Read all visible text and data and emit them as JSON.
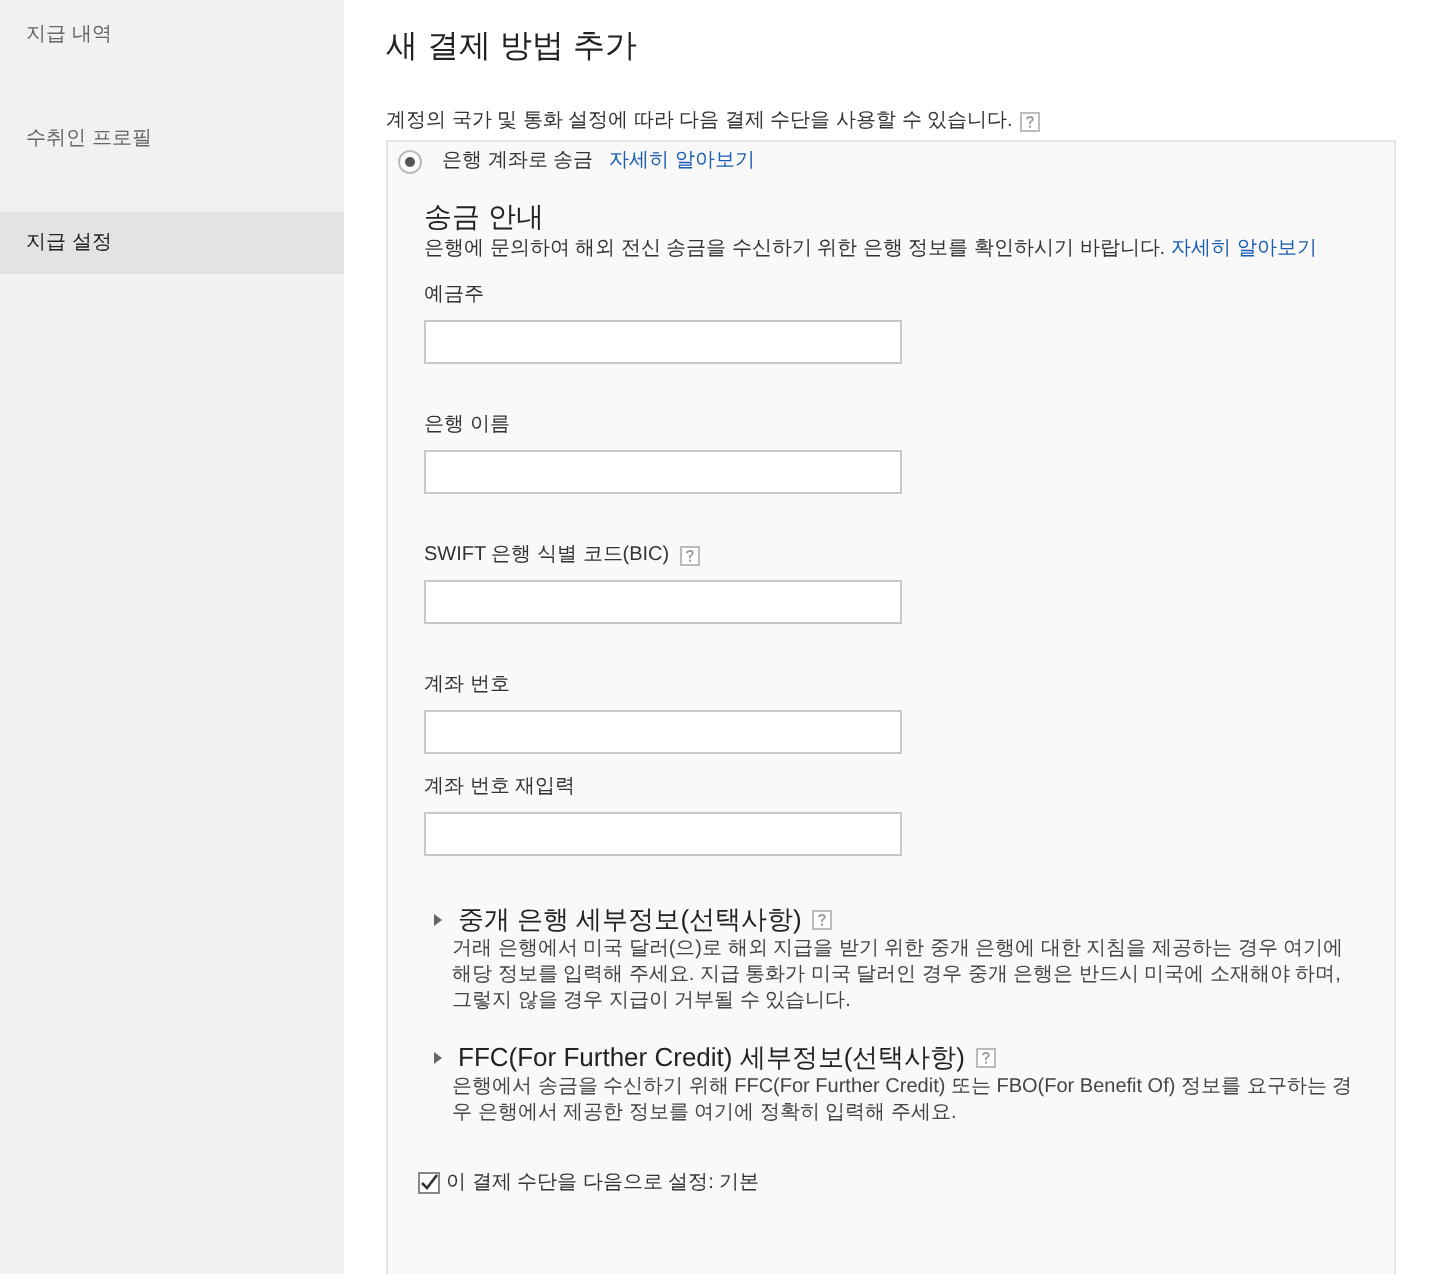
{
  "sidebar": {
    "items": [
      {
        "label": "지급 내역",
        "selected": false
      },
      {
        "label": "수취인 프로필",
        "selected": false
      },
      {
        "label": "지급 설정",
        "selected": true
      }
    ]
  },
  "title": "새 결제 방법 추가",
  "intro": "계정의 국가 및 통화 설정에 따라 다음 결제 수단을 사용할 수 있습니다.",
  "method": {
    "label": "은행 계좌로 송금",
    "selected": true,
    "link": "자세히 알아보기"
  },
  "guide": {
    "heading": "송금 안내",
    "text": "은행에 문의하여 해외 전신 송금을 수신하기 위한 은행 정보를 확인하시기 바랍니다.",
    "link": "자세히 알아보기"
  },
  "fields": [
    {
      "label": "예금주",
      "help": false
    },
    {
      "label": "은행 이름",
      "help": false
    },
    {
      "label": "SWIFT 은행 식별 코드(BIC)",
      "help": true
    },
    {
      "label": "계좌 번호",
      "help": false
    },
    {
      "label": "계좌 번호 재입력",
      "help": false
    }
  ],
  "sections": [
    {
      "heading": "중개 은행 세부정보(선택사항)",
      "expanded": false,
      "text": "거래 은행에서 미국 달러(으)로 해외 지급을 받기 위한 중개 은행에 대한 지침을 제공하는 경우 여기에 해당 정보를 입력해 주세요. 지급 통화가 미국 달러인 경우 중개 은행은 반드시 미국에 소재해야 하며, 그렇지 않을 경우 지급이 거부될 수 있습니다."
    },
    {
      "heading": "FFC(For Further Credit) 세부정보(선택사항)",
      "expanded": false,
      "text": "은행에서 송금을 수신하기 위해 FFC(For Further Credit) 또는 FBO(For Benefit Of) 정보를 요구하는 경우 은행에서 제공한 정보를 여기에 정확히 입력해 주세요."
    }
  ],
  "default_option": {
    "label": "이 결제 수단을 다음으로 설정: 기본",
    "checked": true
  }
}
